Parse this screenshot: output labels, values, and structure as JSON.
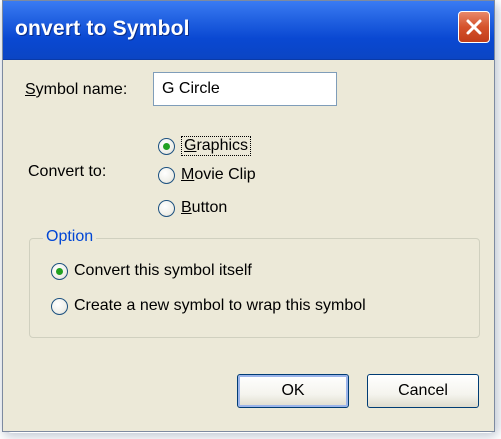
{
  "window": {
    "title": "onvert to Symbol",
    "close_icon": "close-x-icon",
    "close_color": "#d5522c"
  },
  "form": {
    "symbol_name_label": "Symbol name:",
    "symbol_name_value": "G Circle",
    "convert_to_label": "Convert to:",
    "convert_to_options": [
      {
        "label": "Graphics",
        "selected": true
      },
      {
        "label": "Movie Clip",
        "selected": false
      },
      {
        "label": "Button",
        "selected": false
      }
    ]
  },
  "option_group": {
    "title": "Option",
    "options": [
      {
        "label": "Convert this symbol itself",
        "selected": true
      },
      {
        "label": "Create a new symbol to wrap this symbol",
        "selected": false
      }
    ]
  },
  "buttons": {
    "ok_label": "OK",
    "cancel_label": "Cancel"
  },
  "colors": {
    "titlebar": "#0a48d2",
    "dialog_bg": "#ece9d8",
    "group_title": "#0046d5",
    "radio_dot": "#21a121"
  }
}
